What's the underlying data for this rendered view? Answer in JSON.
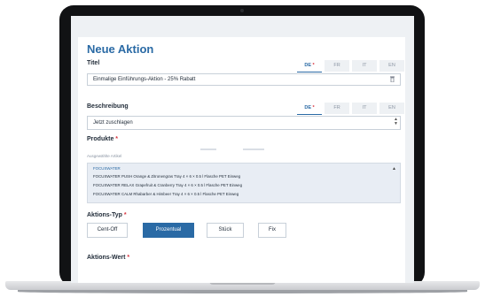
{
  "form": {
    "heading": "Neue Aktion",
    "titel_label": "Titel",
    "title_value": "Einmalige Einführungs-Aktion - 25% Rabatt",
    "beschreibung_label": "Beschreibung",
    "description_value": "Jetzt zuschlagen",
    "produkte_label": "Produkte",
    "selected_hint": "Ausgewählte Artikel",
    "required_mark": "*",
    "aktionstyp_label": "Aktions-Typ",
    "aktionswert_label": "Aktions-Wert"
  },
  "languages": {
    "title_tabs": [
      "DE",
      "FR",
      "IT",
      "EN"
    ],
    "description_tabs": [
      "DE",
      "FR",
      "IT",
      "EN"
    ],
    "active": "DE"
  },
  "products": {
    "group": "FOCUSWATER",
    "items": [
      "FOCUSWATER PUSH Orange & Zitronengras Tray 4 × 6 × 0.5 l Flasche PET Einweg",
      "FOCUSWATER RELAX Grapefruit & Cranberry Tray 4 × 6 × 0.5 l Flasche PET Einweg",
      "FOCUSWATER CALM Rhabarber & Himbeer Tray 4 × 6 × 0.5 l Flasche PET Einweg"
    ]
  },
  "action_types": {
    "options": [
      "Cent-Off",
      "Prozentual",
      "Stück",
      "Fix"
    ],
    "selected": "Prozentual"
  },
  "icons": {
    "trash": "trash-icon",
    "scroll": "scroll-arrows-icon",
    "caret": "caret-up-icon"
  },
  "colors": {
    "primary": "#2a6aa5",
    "required": "#d8333e",
    "frame": "#111214"
  }
}
